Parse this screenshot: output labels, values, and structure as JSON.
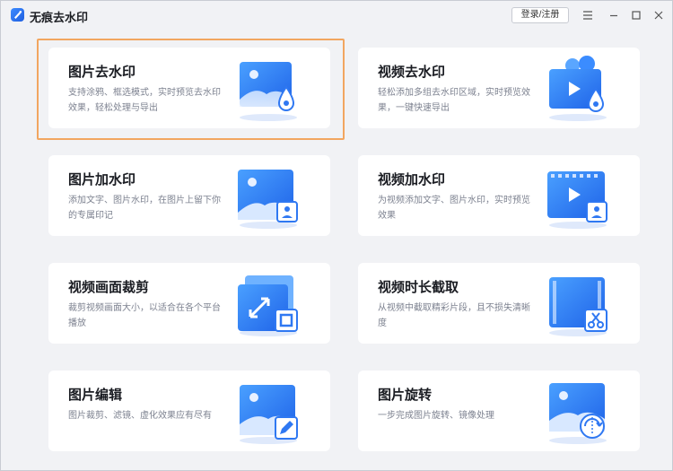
{
  "app": {
    "title": "无痕去水印",
    "login_label": "登录/注册"
  },
  "window_controls": {
    "menu": "menu-icon",
    "minimize": "minimize-icon",
    "maximize": "maximize-icon",
    "close": "close-icon"
  },
  "colors": {
    "accent": "#2b7bf6",
    "selection": "#f2a660",
    "background": "#f1f2f5",
    "card": "#ffffff"
  },
  "cards": [
    {
      "title": "图片去水印",
      "desc": "支持涂鸦、框选模式，实时预览去水印效果，轻松处理与导出",
      "icon": "image-remove-watermark-icon",
      "selected": true
    },
    {
      "title": "视频去水印",
      "desc": "轻松添加多组去水印区域，实时预览效果，一键快速导出",
      "icon": "video-remove-watermark-icon",
      "selected": false
    },
    {
      "title": "图片加水印",
      "desc": "添加文字、图片水印，在图片上留下你的专属印记",
      "icon": "image-add-watermark-icon",
      "selected": false
    },
    {
      "title": "视频加水印",
      "desc": "为视频添加文字、图片水印，实时预览效果",
      "icon": "video-add-watermark-icon",
      "selected": false
    },
    {
      "title": "视频画面裁剪",
      "desc": "裁剪视频画面大小，以适合在各个平台播放",
      "icon": "video-crop-icon",
      "selected": false
    },
    {
      "title": "视频时长截取",
      "desc": "从视频中截取精彩片段，且不损失清晰度",
      "icon": "video-trim-icon",
      "selected": false
    },
    {
      "title": "图片编辑",
      "desc": "图片裁剪、滤镜、虚化效果应有尽有",
      "icon": "image-edit-icon",
      "selected": false
    },
    {
      "title": "图片旋转",
      "desc": "一步完成图片旋转、镜像处理",
      "icon": "image-rotate-icon",
      "selected": false
    }
  ]
}
